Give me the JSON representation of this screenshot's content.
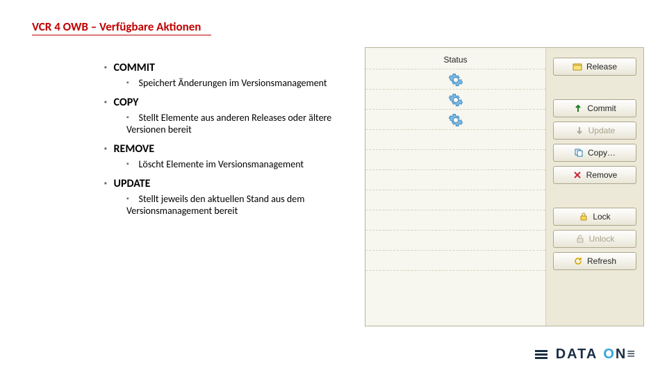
{
  "title": {
    "prefix": "VCR 4 OWB",
    "dash": " – ",
    "subject": "Verfügbare Aktionen"
  },
  "actions": [
    {
      "name": "COMMIT",
      "desc": "Speichert Änderungen im Versionsmanagement"
    },
    {
      "name": "COPY",
      "desc": "Stellt Elemente aus anderen Releases oder ältere Versionen bereit"
    },
    {
      "name": "REMOVE",
      "desc": "Löscht Elemente im Versionsmanagement"
    },
    {
      "name": "UPDATE",
      "desc": "Stellt jeweils den aktuellen Stand aus dem Versionsmanagement bereit"
    }
  ],
  "panel": {
    "status_header": "Status",
    "gear_rows": 3,
    "buttons": {
      "release": {
        "label": "Release",
        "enabled": true
      },
      "commit": {
        "label": "Commit",
        "enabled": true
      },
      "update": {
        "label": "Update",
        "enabled": false
      },
      "copy": {
        "label": "Copy…",
        "enabled": true
      },
      "remove": {
        "label": "Remove",
        "enabled": true
      },
      "lock": {
        "label": "Lock",
        "enabled": true
      },
      "unlock": {
        "label": "Unlock",
        "enabled": false
      },
      "refresh": {
        "label": "Refresh",
        "enabled": true
      }
    }
  },
  "logo": {
    "text1": "DATA",
    "text2": "ONE"
  }
}
